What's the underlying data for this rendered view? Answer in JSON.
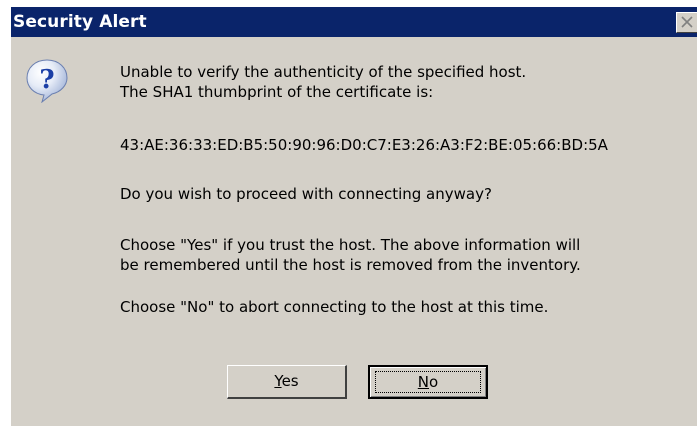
{
  "window": {
    "title": "Security Alert",
    "close_glyph": "✕"
  },
  "dialog": {
    "icon": "question-icon",
    "line1": "Unable to verify the authenticity of the specified host.",
    "line2": "The SHA1 thumbprint of the certificate is:",
    "thumbprint": "43:AE:36:33:ED:B5:50:90:96:D0:C7:E3:26:A3:F2:BE:05:66:BD:5A",
    "question": "Do you wish to proceed with connecting anyway?",
    "yes_info_line1": "Choose \"Yes\" if you trust the host. The above information will",
    "yes_info_line2": "be remembered until the host is removed from the inventory.",
    "no_info": "Choose \"No\" to abort connecting to the host at this time."
  },
  "buttons": {
    "yes_accel": "Y",
    "yes_rest": "es",
    "no_accel": "N",
    "no_rest": "o"
  },
  "colors": {
    "titlebar": "#0a246a",
    "dialog_bg": "#d4d0c8",
    "icon_blue": "#1b3fa6"
  }
}
